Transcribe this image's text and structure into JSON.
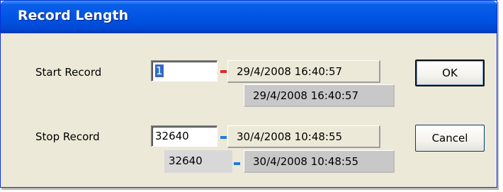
{
  "dialog": {
    "title": "Record Length"
  },
  "start": {
    "label": "Start Record",
    "input_value": "1",
    "datetime_primary": "29/4/2008  16:40:57",
    "datetime_secondary": "29/4/2008  16:40:57",
    "dash_color": "#e0262b"
  },
  "stop": {
    "label": "Stop Record",
    "input_value": "32640",
    "datetime_primary": "30/4/2008  10:48:55",
    "secondary_value": "32640",
    "datetime_secondary": "30/4/2008  10:48:55",
    "dash_color": "#1e7be0"
  },
  "buttons": {
    "ok": "OK",
    "cancel": "Cancel"
  }
}
